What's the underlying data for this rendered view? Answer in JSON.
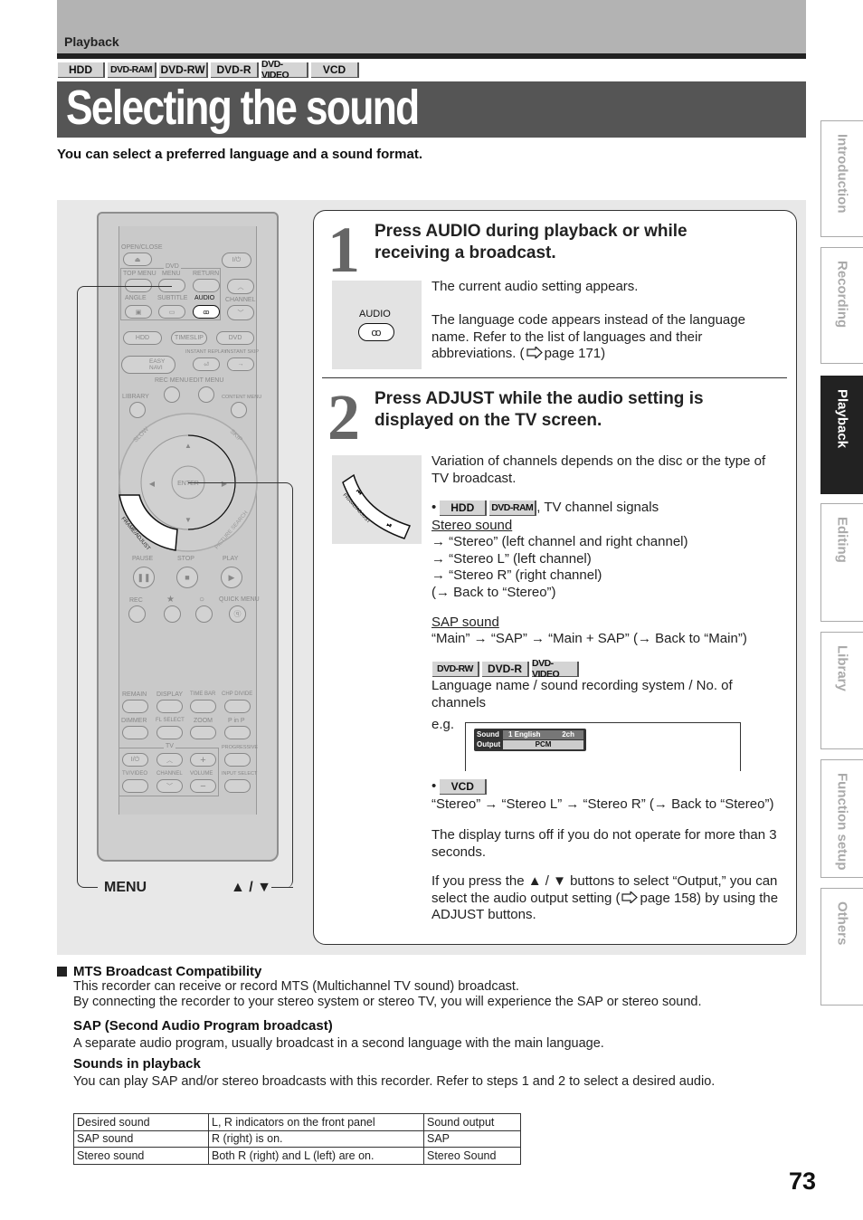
{
  "header": {
    "section": "Playback",
    "badges": [
      "HDD",
      "DVD-RAM",
      "DVD-RW",
      "DVD-R",
      "DVD-VIDEO",
      "VCD"
    ],
    "title": "Selecting the sound",
    "subtitle": "You can select a preferred language and a sound format."
  },
  "remote": {
    "labels": {
      "open_close": "OPEN/CLOSE",
      "dvd": "DVD",
      "top_menu": "TOP MENU",
      "menu": "MENU",
      "return": "RETURN",
      "angle": "ANGLE",
      "subtitle": "SUBTITLE",
      "audio": "AUDIO",
      "channel": "CHANNEL",
      "hdd": "HDD",
      "timeslip": "TIMESLIP",
      "dvd_btn": "DVD",
      "instant_replay": "INSTANT REPLAY",
      "instant_skip": "INSTANT SKIP",
      "easy_navi": "EASY NAVI",
      "rec_menu": "REC MENU",
      "edit_menu": "EDIT MENU",
      "library": "LIBRARY",
      "content_menu": "CONTENT MENU",
      "slow": "SLOW",
      "skip": "SKIP",
      "enter": "ENTER",
      "frame_adjust": "FRAME/ADJUST",
      "picture_search": "PICTURE SEARCH",
      "pause": "PAUSE",
      "stop": "STOP",
      "play": "PLAY",
      "rec": "REC",
      "star": "★",
      "circle": "○",
      "quick_menu": "QUICK MENU",
      "remain": "REMAIN",
      "display": "DISPLAY",
      "time_bar": "TIME BAR",
      "chp_divide": "CHP DIVIDE",
      "dimmer": "DIMMER",
      "fl_select": "FL SELECT",
      "zoom": "ZOOM",
      "p_in_p": "P in P",
      "tv": "TV",
      "progressive": "PROGRESSIVE",
      "tv_video": "TV/VIDEO",
      "tv_channel": "CHANNEL",
      "volume": "VOLUME",
      "input_select": "INPUT SELECT",
      "power": "I/⏻",
      "tv_power": "I/⏻"
    },
    "callout_menu": "MENU",
    "callout_updown": "▲ / ▼"
  },
  "steps": [
    {
      "number": "1",
      "title": "Press AUDIO during playback or while receiving a broadcast.",
      "image_label": "AUDIO",
      "paragraphs": [
        "The current audio setting appears.",
        "The language code appears instead of the language name. Refer to the list of languages and their abbreviations. (",
        "page 171)"
      ]
    },
    {
      "number": "2",
      "title": "Press ADJUST while the audio setting is displayed on the TV screen.",
      "image_label": "FRAME/ADJUST",
      "intro": "Variation of channels depends on the disc or the type of TV broadcast.",
      "hdd_badges": [
        "HDD",
        "DVD-RAM"
      ],
      "hdd_suffix": ", TV channel signals",
      "stereo_heading": "Stereo sound",
      "stereo_lines": [
        "→ “Stereo” (left channel and right channel)",
        "→ “Stereo L” (left channel)",
        "→ “Stereo R” (right channel)",
        "(→ Back to “Stereo”)"
      ],
      "sap_heading": "SAP sound",
      "sap_line": "“Main” → “SAP” → “Main + SAP” (→ Back to “Main”)",
      "dvd_badges": [
        "DVD-RW",
        "DVD-R",
        "DVD-VIDEO"
      ],
      "dvd_text": "Language name / sound recording system / No. of channels",
      "eg": "e.g.",
      "osd": {
        "row1_label": "Sound",
        "row1_value": "1  English",
        "row1_ch": "2ch",
        "row2_label": "Output",
        "row2_value": "PCM"
      },
      "vcd_badge": "VCD",
      "vcd_line": "“Stereo” → “Stereo L” → “Stereo R” (→ Back to “Stereo”)",
      "display_off": "The display turns off if you do not operate for more than 3 seconds.",
      "output_note_1": "If you press the ▲ / ▼ buttons to select “Output,” you can select the audio output setting (",
      "output_note_2": "page 158) by using the ADJUST buttons."
    }
  ],
  "side_tabs": [
    {
      "label": "Introduction",
      "active": false
    },
    {
      "label": "Recording",
      "active": false
    },
    {
      "label": "Playback",
      "active": true
    },
    {
      "label": "Editing",
      "active": false
    },
    {
      "label": "Library",
      "active": false
    },
    {
      "label": "Function setup",
      "active": false
    },
    {
      "label": "Others",
      "active": false
    }
  ],
  "notes": {
    "mts_heading": "MTS Broadcast Compatibility",
    "mts_lines": [
      "This recorder can receive or record MTS (Multichannel TV sound) broadcast.",
      "By connecting the recorder to your stereo system or stereo TV, you will experience the SAP or stereo sound."
    ],
    "sap_heading": "SAP (Second Audio Program broadcast)",
    "sap_text": "A separate audio program, usually broadcast in a second language with the main language.",
    "sounds_heading": "Sounds in playback",
    "sounds_text": "You can play SAP and/or stereo broadcasts with this recorder. Refer to steps 1 and 2 to select a desired audio."
  },
  "sound_table": {
    "headers": [
      "Desired sound",
      "L, R indicators on the front panel",
      "Sound output"
    ],
    "rows": [
      [
        "SAP sound",
        "R (right) is on.",
        "SAP"
      ],
      [
        "Stereo sound",
        "Both R (right) and L (left) are on.",
        "Stereo Sound"
      ]
    ]
  },
  "page_number": "73"
}
